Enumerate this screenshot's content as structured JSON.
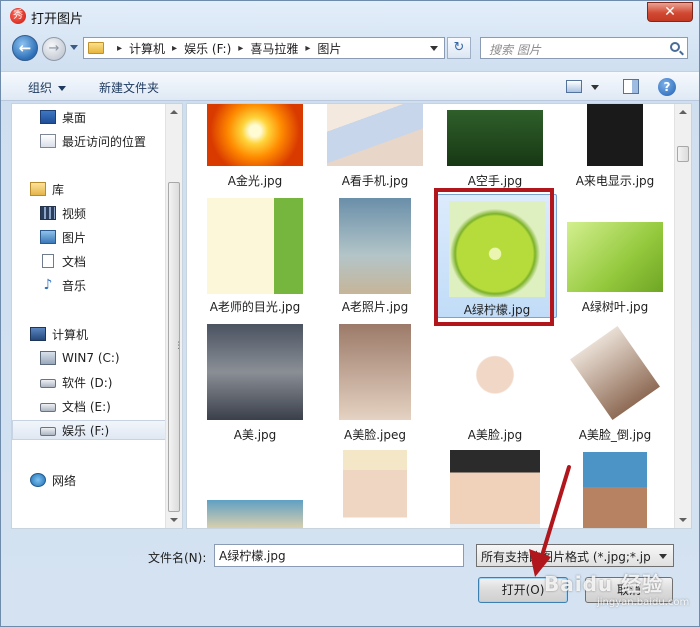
{
  "titlebar": {
    "title": "打开图片",
    "close_glyph": "✕",
    "app_icon_glyph": "秀"
  },
  "nav": {
    "back_glyph": "←",
    "forward_glyph": "→",
    "refresh_glyph": "↻"
  },
  "address": {
    "crumbs": [
      "计算机",
      "娱乐 (F:)",
      "喜马拉雅",
      "图片"
    ],
    "separator": "▸"
  },
  "search": {
    "placeholder": "搜索 图片"
  },
  "toolbar": {
    "organize_label": "组织",
    "new_folder_label": "新建文件夹",
    "help_glyph": "?"
  },
  "navpane": {
    "items": [
      {
        "label": "桌面",
        "icon": "desktop-icon"
      },
      {
        "label": "最近访问的位置",
        "icon": "recent-places-icon"
      },
      {
        "label": "库",
        "icon": "library-icon"
      },
      {
        "label": "视频",
        "icon": "video-icon"
      },
      {
        "label": "图片",
        "icon": "picture-icon"
      },
      {
        "label": "文档",
        "icon": "document-icon"
      },
      {
        "label": "音乐",
        "icon": "music-icon"
      },
      {
        "label": "计算机",
        "icon": "computer-icon"
      },
      {
        "label": "WIN7 (C:)",
        "icon": "os-drive-icon"
      },
      {
        "label": "软件 (D:)",
        "icon": "drive-icon"
      },
      {
        "label": "文档 (E:)",
        "icon": "drive-icon"
      },
      {
        "label": "娱乐 (F:)",
        "icon": "drive-icon"
      },
      {
        "label": "网络",
        "icon": "network-icon"
      }
    ],
    "selected": "娱乐 (F:)"
  },
  "files": [
    {
      "name": "A金光.jpg"
    },
    {
      "name": "A看手机.jpg"
    },
    {
      "name": "A空手.jpg"
    },
    {
      "name": "A来电显示.jpg"
    },
    {
      "name": "A老师的目光.jpg"
    },
    {
      "name": "A老照片.jpg"
    },
    {
      "name": "A绿柠檬.jpg"
    },
    {
      "name": "A绿树叶.jpg"
    },
    {
      "name": "A美.jpg"
    },
    {
      "name": "A美脸.jpeg"
    },
    {
      "name": "A美脸.jpg"
    },
    {
      "name": "A美脸_倒.jpg"
    },
    {
      "name": ""
    },
    {
      "name": ""
    },
    {
      "name": ""
    },
    {
      "name": ""
    }
  ],
  "selected_file": "A绿柠檬.jpg",
  "bottom": {
    "filename_label": "文件名(N):",
    "filename_value": "A绿柠檬.jpg",
    "filter_value": "所有支持的图片格式 (*.jpg;*.jp",
    "open_label": "打开(O)",
    "cancel_label": "取消"
  },
  "watermark": {
    "text": "Baidu 经验",
    "sub": "jingyan.baidu.com"
  },
  "colors": {
    "highlight_frame": "#b0161c",
    "arrow": "#b0161c"
  }
}
